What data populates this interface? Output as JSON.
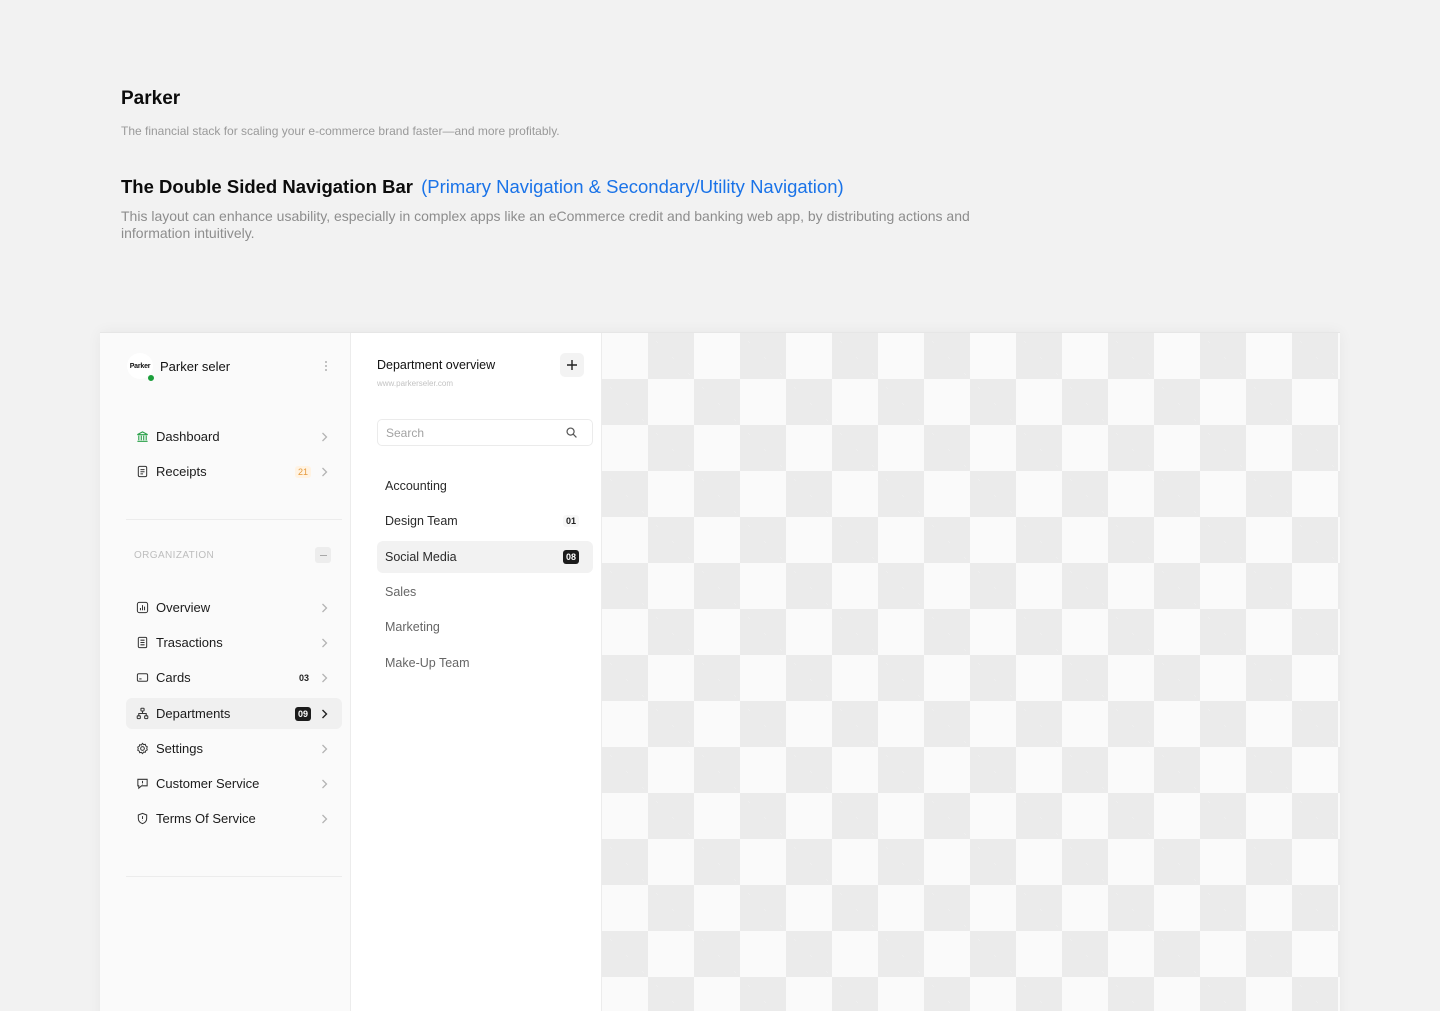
{
  "intro": {
    "brand": "Parker",
    "tagline": "The financial stack for scaling your e-commerce brand faster—and more profitably.",
    "section_title": "The Double Sided Navigation Bar",
    "section_title_accent": "(Primary Navigation & Secondary/Utility Navigation)",
    "section_desc": "This layout can enhance usability, especially in complex apps like an eCommerce credit and banking web app, by distributing actions and information intuitively."
  },
  "colors": {
    "accent": "#1a73e8",
    "status_online": "#1a9e3a",
    "badge_orange": "#e59a3c",
    "badge_dark": "#1c1c1c"
  },
  "sidebar": {
    "avatar_text": "Parker",
    "profile_name": "Parker seler",
    "primary": [
      {
        "label": "Dashboard",
        "icon": "bank-icon"
      },
      {
        "label": "Receipts",
        "icon": "receipt-icon",
        "badge": "21"
      }
    ],
    "org_label": "ORGANIZATION",
    "org_items": [
      {
        "label": "Overview",
        "icon": "chart-icon"
      },
      {
        "label": "Trasactions",
        "icon": "document-icon"
      },
      {
        "label": "Cards",
        "icon": "card-icon",
        "badge": "03"
      },
      {
        "label": "Departments",
        "icon": "org-chart-icon",
        "badge": "09",
        "active": true
      },
      {
        "label": "Settings",
        "icon": "gear-icon"
      },
      {
        "label": "Customer Service",
        "icon": "support-icon"
      },
      {
        "label": "Terms Of Service",
        "icon": "shield-icon"
      }
    ]
  },
  "panel": {
    "title": "Department overview",
    "url": "www.parkerseler.com",
    "search_placeholder": "Search",
    "departments": [
      {
        "label": "Accounting"
      },
      {
        "label": "Design Team",
        "badge": "01"
      },
      {
        "label": "Social Media",
        "badge": "08",
        "active": true
      },
      {
        "label": "Sales"
      },
      {
        "label": "Marketing"
      },
      {
        "label": "Make-Up Team"
      }
    ]
  }
}
